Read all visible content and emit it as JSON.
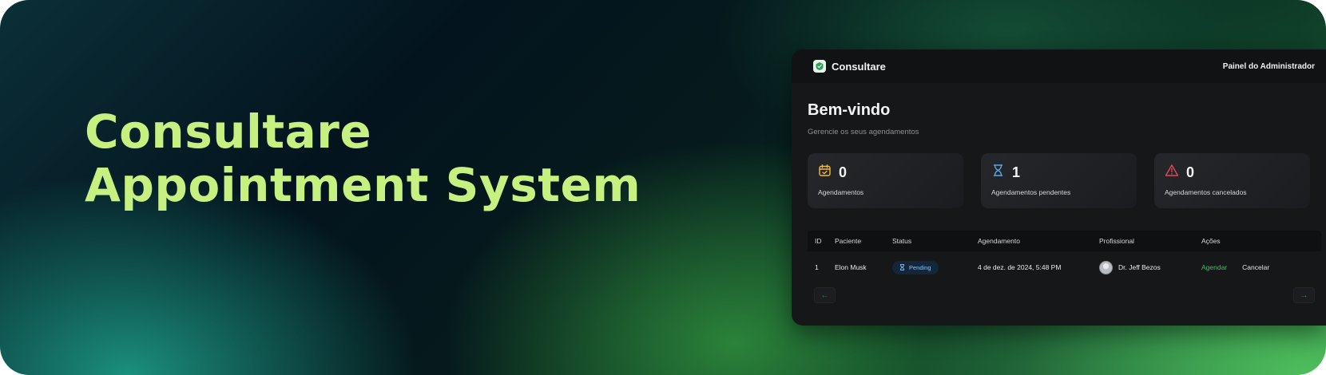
{
  "hero": {
    "line1": "Consultare",
    "line2": "Appointment System"
  },
  "app": {
    "brand": "Consultare",
    "admin_link": "Painel do Administrador",
    "welcome": "Bem-vindo",
    "subtitle": "Gerencie os seus agendamentos"
  },
  "stats": [
    {
      "icon": "calendar-check-icon",
      "value": "0",
      "label": "Agendamentos",
      "color": "#f5b93a"
    },
    {
      "icon": "hourglass-icon",
      "value": "1",
      "label": "Agendamentos pendentes",
      "color": "#5aa7e6"
    },
    {
      "icon": "warning-icon",
      "value": "0",
      "label": "Agendamentos cancelados",
      "color": "#e5484d"
    }
  ],
  "table": {
    "headers": [
      "ID",
      "Paciente",
      "Status",
      "Agendamento",
      "Profissional",
      "Ações"
    ],
    "rows": [
      {
        "id": "1",
        "patient": "Elon Musk",
        "status": "Pending",
        "date": "4 de dez. de 2024, 5:48 PM",
        "professional": "Dr. Jeff Bezos",
        "action_primary": "Agendar",
        "action_cancel": "Cancelar"
      }
    ]
  },
  "pager": {
    "prev": "←",
    "next": "→"
  },
  "colors": {
    "hero_text": "#c6f07f",
    "accent_green": "#3fbf6a",
    "badge_text": "#8ec6f2"
  }
}
